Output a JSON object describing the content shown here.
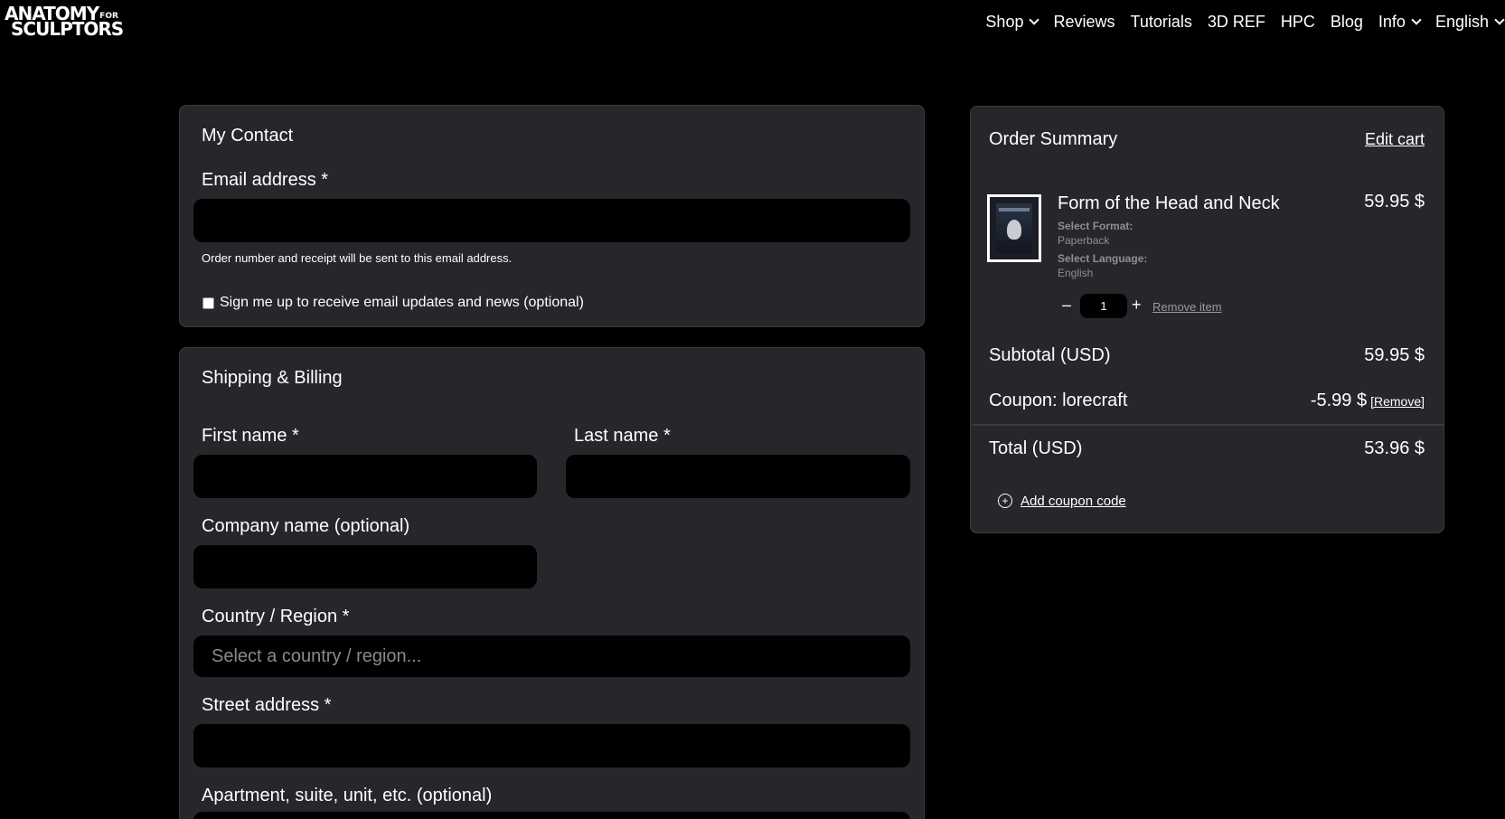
{
  "header": {
    "logo_line1": "ANATOMY",
    "logo_for": "FOR",
    "logo_line2": "SCULPTORS",
    "nav": [
      {
        "label": "Shop"
      },
      {
        "label": "Reviews"
      },
      {
        "label": "Tutorials"
      },
      {
        "label": "3D REF"
      },
      {
        "label": "HPC"
      },
      {
        "label": "Blog"
      },
      {
        "label": "Info"
      },
      {
        "label": "English"
      }
    ]
  },
  "contact": {
    "title": "My Contact",
    "email_label": "Email address *",
    "email_value": "",
    "email_hint": "Order number and receipt will be sent to this email address.",
    "signup_label": "Sign me up to receive email updates and news (optional)"
  },
  "shipping": {
    "title": "Shipping & Billing",
    "first_name_label": "First name *",
    "last_name_label": "Last name *",
    "company_label": "Company name (optional)",
    "country_label": "Country / Region *",
    "country_placeholder": "Select a country / region...",
    "street_label": "Street address *",
    "apartment_label": "Apartment, suite, unit, etc. (optional)"
  },
  "summary": {
    "title": "Order Summary",
    "edit_cart": "Edit cart",
    "item": {
      "name": "Form of the Head and Neck",
      "price": "59.95 $",
      "format_label": "Select Format:",
      "format_value": "Paperback",
      "language_label": "Select Language:",
      "language_value": "English",
      "quantity": "1",
      "minus": "–",
      "plus": "+",
      "remove": "Remove item"
    },
    "subtotal_label": "Subtotal (USD)",
    "subtotal_value": "59.95 $",
    "coupon_label": "Coupon: lorecraft",
    "coupon_value": "-5.99 $",
    "coupon_remove": "[Remove]",
    "total_label": "Total (USD)",
    "total_value": "53.96 $",
    "add_coupon": "Add coupon code"
  }
}
